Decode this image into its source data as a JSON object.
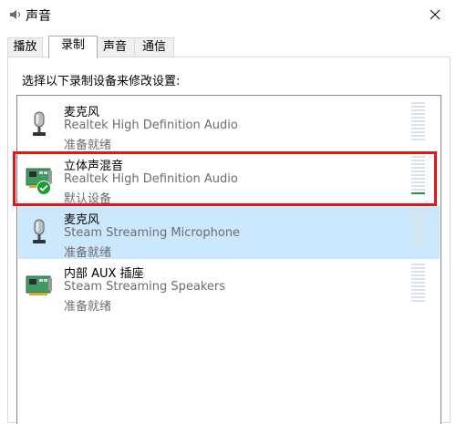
{
  "window": {
    "title": "声音",
    "title_icon": "speaker-icon",
    "close_icon": "close-icon"
  },
  "tabs": [
    {
      "label": "播放",
      "active": false
    },
    {
      "label": "录制",
      "active": true
    },
    {
      "label": "声音",
      "active": false
    },
    {
      "label": "通信",
      "active": false
    }
  ],
  "instruction": "选择以下录制设备来修改设置:",
  "devices": [
    {
      "name": "麦克风",
      "description": "Realtek High Definition Audio",
      "status": "准备就绪",
      "icon": "microphone-icon",
      "selected": false,
      "default": false,
      "level": 0
    },
    {
      "name": "立体声混音",
      "description": "Realtek High Definition Audio",
      "status": "默认设备",
      "icon": "sound-card-icon",
      "selected": false,
      "default": true,
      "level": 1
    },
    {
      "name": "麦克风",
      "description": "Steam Streaming Microphone",
      "status": "准备就绪",
      "icon": "microphone-icon",
      "selected": true,
      "default": false,
      "level": 0
    },
    {
      "name": "内部 AUX 插座",
      "description": "Steam Streaming Speakers",
      "status": "准备就绪",
      "icon": "sound-card-icon",
      "selected": false,
      "default": false,
      "level": 0
    }
  ],
  "colors": {
    "selection": "#cce8ff",
    "highlight_box": "#e01818",
    "meter_active": "#1f9b3c",
    "default_badge": "#1a9e2e"
  }
}
